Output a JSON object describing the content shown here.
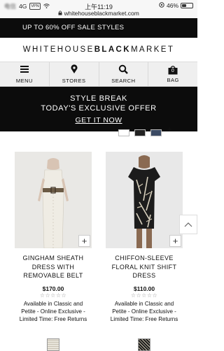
{
  "status_bar": {
    "carrier": "电信",
    "network": "4G",
    "vpn": "VPN",
    "time": "上午11:19",
    "battery_label": "46%",
    "battery_level": 0.46,
    "url": "whitehouseblackmarket.com"
  },
  "promo": {
    "text": "UP TO 60% OFF SALE STYLES"
  },
  "logo": {
    "part1": "WHITE",
    "part2": "HOUSE",
    "part3": "BLACK",
    "part4": "MARKET"
  },
  "nav": [
    {
      "label": "MENU",
      "icon": "menu-icon"
    },
    {
      "label": "STORES",
      "icon": "location-pin-icon"
    },
    {
      "label": "SEARCH",
      "icon": "search-icon"
    },
    {
      "label": "BAG",
      "icon": "bag-icon",
      "count": "0"
    }
  ],
  "hero": {
    "line1": "STYLE BREAK",
    "line2": "TODAY'S EXCLUSIVE OFFER",
    "cta": "GET IT NOW"
  },
  "swatches": {
    "colors": [
      "#ffffff",
      "#222222",
      "#3b4a63"
    ],
    "more": "+"
  },
  "products": [
    {
      "name_line1": "GINGHAM SHEATH",
      "name_line2": "DRESS WITH",
      "name_line3": "REMOVABLE BELT",
      "price": "$170.00",
      "stars": "☆☆☆☆☆",
      "avail_line1": "Available in Classic and",
      "avail_line2": "Petite - Online Exclusive -",
      "avail_line3": "Limited Time: Free Returns",
      "add": "+"
    },
    {
      "name_line1": "CHIFFON-SLEEVE",
      "name_line2": "FLORAL KNIT SHIFT",
      "name_line3": "DRESS",
      "price": "$110.00",
      "stars": "☆☆☆☆☆",
      "avail_line1": "Available in Classic and",
      "avail_line2": "Petite - Online Exclusive -",
      "avail_line3": "Limited Time: Free Returns",
      "add": "+"
    }
  ],
  "colors": {
    "black": "#0c0c0c",
    "nav_bg": "#efefef"
  }
}
